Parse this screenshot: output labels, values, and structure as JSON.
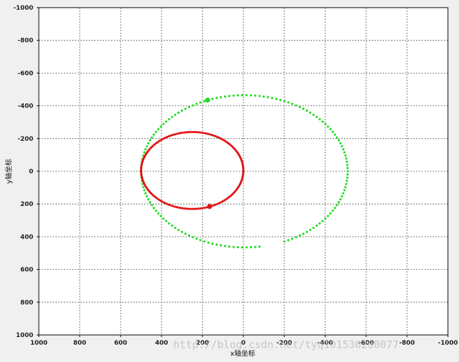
{
  "chart_data": {
    "type": "scatter",
    "title": "",
    "xlabel": "x轴坐标",
    "ylabel": "y轴坐标",
    "xlim": [
      1000,
      -1000
    ],
    "ylim": [
      -1000,
      1000
    ],
    "x_reversed": true,
    "y_inverted": true,
    "x_ticks": [
      1000,
      800,
      600,
      400,
      200,
      0,
      -200,
      -400,
      -600,
      -800,
      -1000
    ],
    "y_ticks": [
      -1000,
      -800,
      -600,
      -400,
      -200,
      0,
      200,
      400,
      600,
      800,
      1000
    ],
    "grid": true,
    "grid_style": "dashed",
    "series": [
      {
        "color": "#22dd22",
        "shape": "ellipse",
        "center": [
          -5,
          0
        ],
        "radii": [
          505,
          465
        ],
        "point_count": 150,
        "marker": [
          175,
          -435
        ],
        "gap_from_angle_deg": 100,
        "gap_to_angle_deg": 112
      },
      {
        "color": "#e01515",
        "shape": "ellipse",
        "center": [
          250,
          -5
        ],
        "radii": [
          250,
          235
        ],
        "point_count": 160,
        "marker": [
          165,
          215
        ],
        "gap_from_angle_deg": 0,
        "gap_to_angle_deg": 0
      }
    ]
  },
  "watermark": "http://blog.csdn.net/tyq101530200077"
}
